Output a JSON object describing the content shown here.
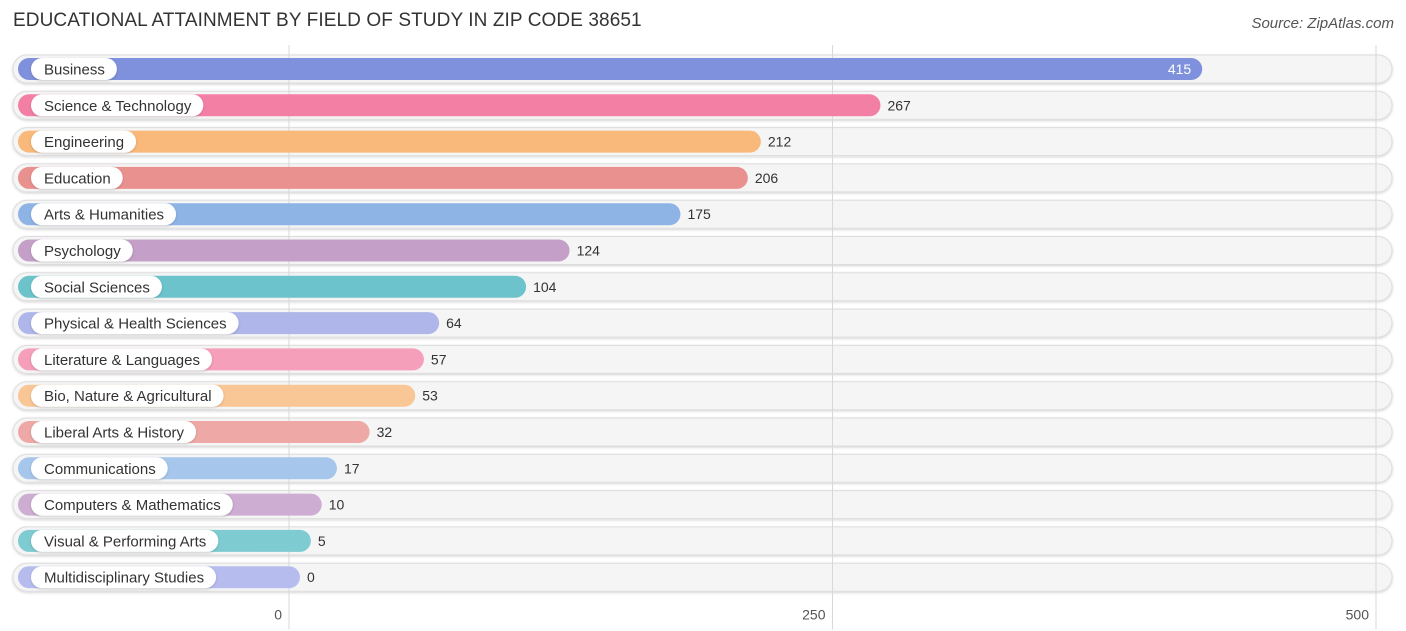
{
  "header": {
    "title": "EDUCATIONAL ATTAINMENT BY FIELD OF STUDY IN ZIP CODE 38651",
    "source": "Source: ZipAtlas.com"
  },
  "chart_data": {
    "type": "bar",
    "orientation": "horizontal",
    "title": "EDUCATIONAL ATTAINMENT BY FIELD OF STUDY IN ZIP CODE 38651",
    "xlabel": "",
    "ylabel": "",
    "xlim": [
      0,
      500
    ],
    "xticks": [
      0,
      250,
      500
    ],
    "grid": true,
    "categories": [
      "Business",
      "Science & Technology",
      "Engineering",
      "Education",
      "Arts & Humanities",
      "Psychology",
      "Social Sciences",
      "Physical & Health Sciences",
      "Literature & Languages",
      "Bio, Nature & Agricultural",
      "Liberal Arts & History",
      "Communications",
      "Computers & Mathematics",
      "Visual & Performing Arts",
      "Multidisciplinary Studies"
    ],
    "values": [
      415,
      267,
      212,
      206,
      175,
      124,
      104,
      64,
      57,
      53,
      32,
      17,
      10,
      5,
      0
    ],
    "colors": [
      "#7f91dc",
      "#f47fa4",
      "#f9b97a",
      "#e9918f",
      "#8db4e5",
      "#c49fc8",
      "#6cc3cc",
      "#aeb6ea",
      "#f59fbb",
      "#f9c796",
      "#eea9a7",
      "#a6c6ec",
      "#cdadd2",
      "#7ecbd1",
      "#b6bdee"
    ]
  }
}
